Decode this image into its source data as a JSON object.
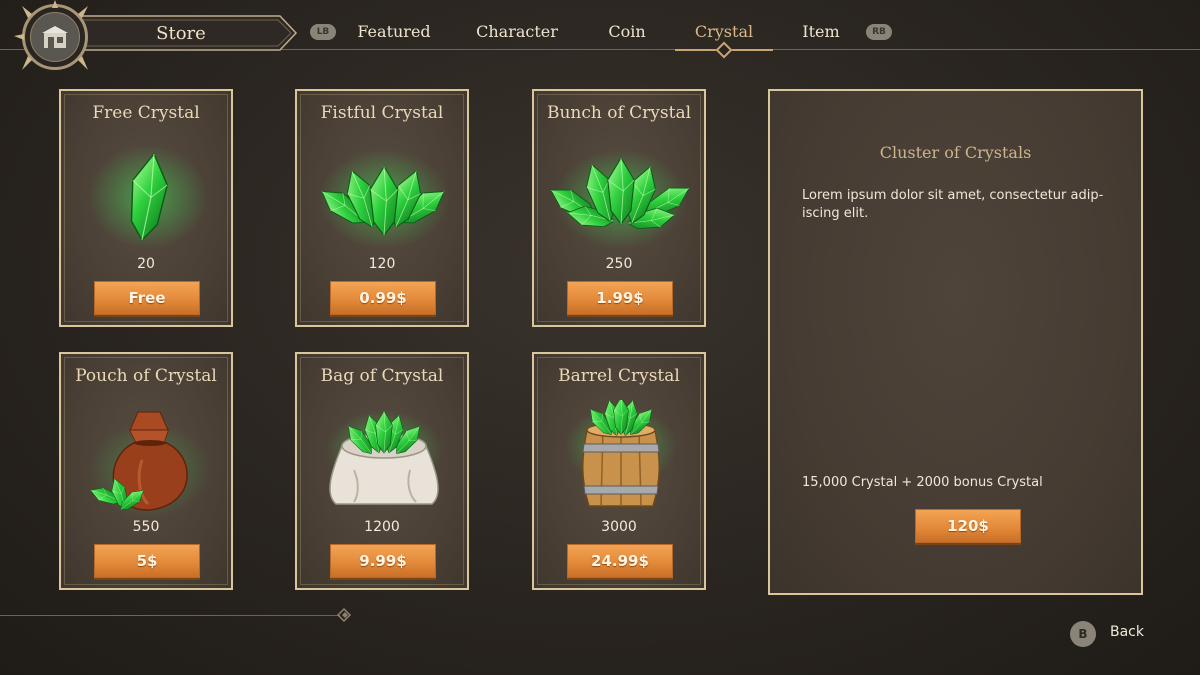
{
  "header": {
    "store_label": "Store",
    "lb_hint": "LB",
    "rb_hint": "RB",
    "tabs": [
      {
        "label": "Featured"
      },
      {
        "label": "Character"
      },
      {
        "label": "Coin"
      },
      {
        "label": "Crystal",
        "active": true
      },
      {
        "label": "Item"
      }
    ]
  },
  "products": [
    {
      "title": "Free Crystal",
      "amount": "20",
      "price": "Free",
      "icon": "single-crystal-icon"
    },
    {
      "title": "Fistful Crystal",
      "amount": "120",
      "price": "0.99$",
      "icon": "crystal-cluster-icon"
    },
    {
      "title": "Bunch of Crystal",
      "amount": "250",
      "price": "1.99$",
      "icon": "crystal-bunch-icon"
    },
    {
      "title": "Pouch of Crystal",
      "amount": "550",
      "price": "5$",
      "icon": "crystal-pouch-icon"
    },
    {
      "title": "Bag of Crystal",
      "amount": "1200",
      "price": "9.99$",
      "icon": "crystal-bag-icon"
    },
    {
      "title": "Barrel Crystal",
      "amount": "3000",
      "price": "24.99$",
      "icon": "crystal-barrel-icon"
    }
  ],
  "detail": {
    "title": "Cluster of Crystals",
    "description": "Lorem ipsum dolor sit amet, consectetur adip- iscing elit.",
    "subtitle": "15,000 Crystal + 2000 bonus Crystal",
    "price": "120$"
  },
  "footer": {
    "back_hint": "B",
    "back_label": "Back"
  },
  "colors": {
    "accent_gold": "#d9c69a",
    "button_orange": "#e38a3a",
    "crystal_green": "#3fd84a",
    "background": "#2a2520"
  }
}
